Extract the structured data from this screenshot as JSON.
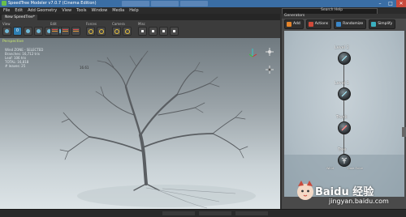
{
  "window": {
    "title": "SpeedTree Modeler v7.0.7 (Cinema Edition)",
    "minimize": "–",
    "maximize": "□",
    "close": "✕"
  },
  "menu": {
    "items": [
      "File",
      "Edit",
      "Add Geometry",
      "View",
      "Tools",
      "Window",
      "Media",
      "Help"
    ],
    "search_label": "Search Help"
  },
  "document": {
    "tab_label": "New SpeedTree*"
  },
  "toolbar": {
    "groups": [
      {
        "label": "View"
      },
      {
        "label": "Edit"
      },
      {
        "label": "Forces"
      },
      {
        "label": "Camera"
      },
      {
        "label": "Misc"
      }
    ],
    "counter_value": "0"
  },
  "viewport": {
    "label": "Perspective",
    "stats": [
      "Wind ZONE - SELECTED",
      "Branches: 16,712 tris",
      "Leaf: 106 tris",
      "TOTAL: 16,818",
      "",
      "# leaves: 25"
    ],
    "dim_label": "16.61"
  },
  "panel": {
    "title": "Generators",
    "buttons": [
      {
        "label": "Add",
        "color": "#e5842a"
      },
      {
        "label": "Actions",
        "color": "#d04a3a"
      },
      {
        "label": "Randomize",
        "color": "#3a86c8"
      },
      {
        "label": "Simplify",
        "color": "#3bb0c0"
      }
    ],
    "nodes": [
      "Level 2",
      "Level 1",
      "Trunk",
      "Tree"
    ],
    "tree_sub_labels": [
      "Wind",
      "Data Force"
    ]
  },
  "watermark": {
    "text": "Baidu 经验",
    "url": "jingyan.baidu.com"
  },
  "icons": {
    "app": "speedtree-logo-icon",
    "axis": "axis-gizmo-icon",
    "navigate": "camera-navigate-icon"
  }
}
